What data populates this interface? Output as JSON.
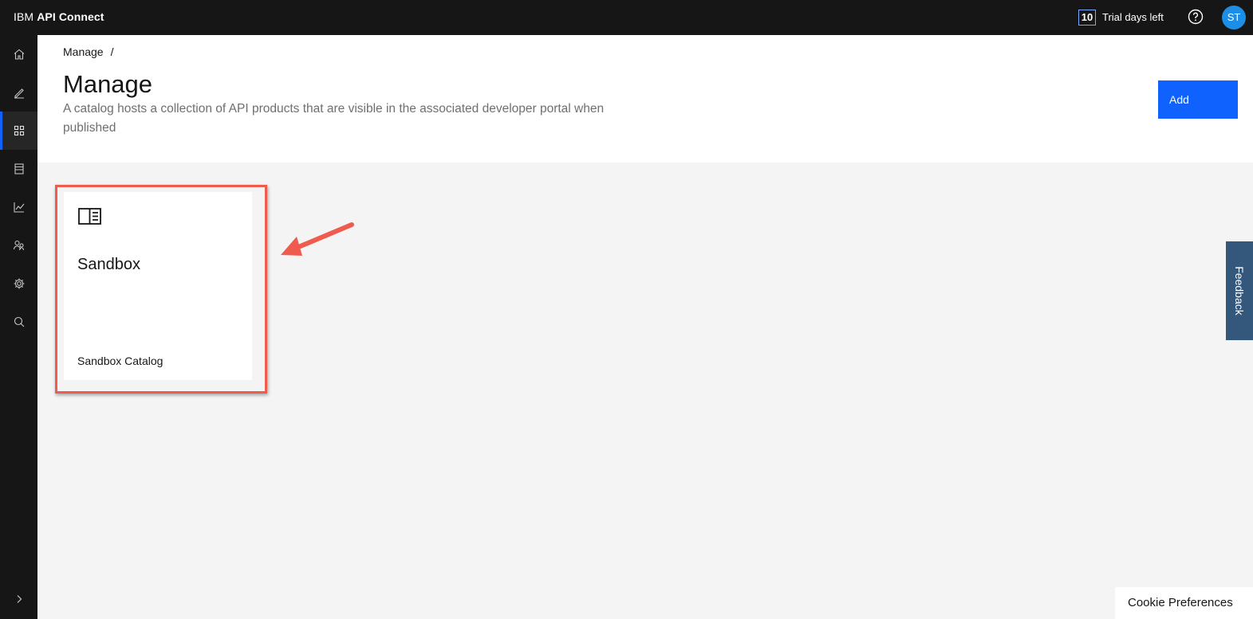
{
  "topbar": {
    "brand_prefix": "IBM",
    "brand_name": "API Connect",
    "trial_days": "10",
    "trial_label": "Trial days left",
    "avatar_initials": "ST"
  },
  "sidenav": {
    "items": [
      {
        "icon": "home-icon"
      },
      {
        "icon": "edit-icon"
      },
      {
        "icon": "grid-icon",
        "active": true
      },
      {
        "icon": "archive-icon"
      },
      {
        "icon": "analytics-icon"
      },
      {
        "icon": "users-icon"
      },
      {
        "icon": "settings-icon"
      },
      {
        "icon": "search-icon"
      }
    ],
    "expand_icon": "chevron-right-icon"
  },
  "header": {
    "breadcrumb": "Manage",
    "breadcrumb_separator": "/",
    "title": "Manage",
    "description": "A catalog hosts a collection of API products that are visible in the associated developer portal when published",
    "add_label": "Add"
  },
  "catalogs": [
    {
      "title": "Sandbox",
      "subtitle": "Sandbox Catalog",
      "icon": "catalog-icon"
    }
  ],
  "feedback_label": "Feedback",
  "cookie_label": "Cookie Preferences",
  "colors": {
    "accent": "#0f62fe",
    "highlight": "#ef5b4e",
    "feedback_bg": "#34577c",
    "avatar_bg": "#1d8ee6"
  }
}
